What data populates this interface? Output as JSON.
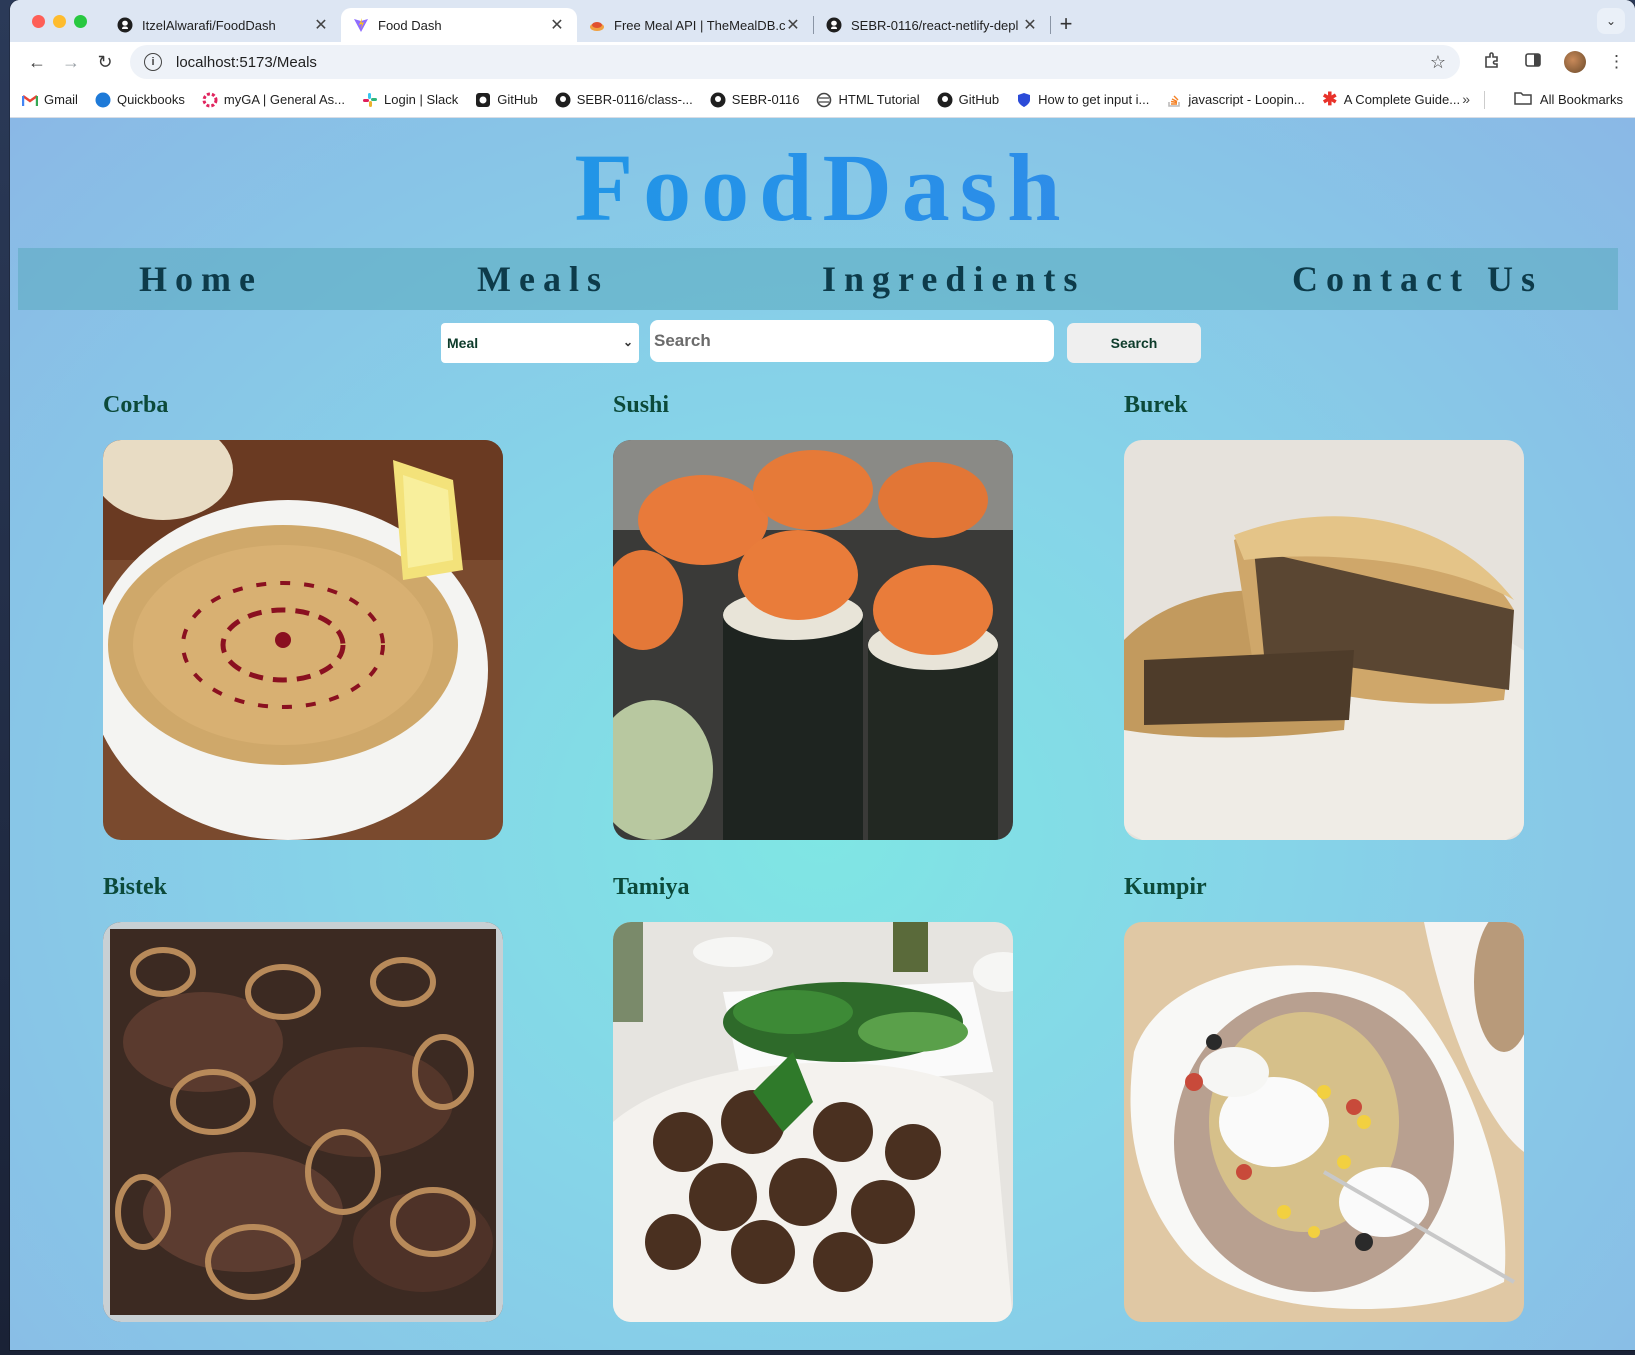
{
  "browser": {
    "tabs": [
      {
        "title": "ItzelAlwarafi/FoodDash",
        "icon": "github-icon",
        "active": false
      },
      {
        "title": "Food Dash",
        "icon": "vite-icon",
        "active": true
      },
      {
        "title": "Free Meal API | TheMealDB.co",
        "icon": "mealdb-icon",
        "active": false
      },
      {
        "title": "SEBR-0116/react-netlify-depl",
        "icon": "github-icon",
        "active": false
      }
    ],
    "new_tab": "+",
    "url": "localhost:5173/Meals",
    "bookmarks": [
      {
        "label": "Gmail",
        "icon": "gmail-icon"
      },
      {
        "label": "Quickbooks",
        "icon": "quickbooks-icon"
      },
      {
        "label": "myGA | General As...",
        "icon": "ga-icon"
      },
      {
        "label": "Login | Slack",
        "icon": "slack-icon"
      },
      {
        "label": "GitHub",
        "icon": "github-icon"
      },
      {
        "label": "SEBR-0116/class-...",
        "icon": "github-icon"
      },
      {
        "label": "SEBR-0116",
        "icon": "github-icon"
      },
      {
        "label": "HTML Tutorial",
        "icon": "globe-icon"
      },
      {
        "label": "GitHub",
        "icon": "github-icon"
      },
      {
        "label": "How to get input i...",
        "icon": "shield-icon"
      },
      {
        "label": "javascript - Loopin...",
        "icon": "stackoverflow-icon"
      },
      {
        "label": "A Complete Guide...",
        "icon": "asterisk-icon"
      }
    ],
    "all_bookmarks": "All Bookmarks"
  },
  "app": {
    "brand": "FoodDash",
    "nav": [
      "Home",
      "Meals",
      "Ingredients",
      "Contact Us"
    ],
    "search": {
      "select_value": "Meal",
      "placeholder": "Search",
      "button": "Search"
    },
    "meals": [
      {
        "name": "Corba"
      },
      {
        "name": "Sushi"
      },
      {
        "name": "Burek"
      },
      {
        "name": "Bistek"
      },
      {
        "name": "Tamiya"
      },
      {
        "name": "Kumpir"
      }
    ]
  },
  "colors": {
    "brand_gradient": [
      "#16a0e6",
      "#4f87e8"
    ],
    "nav_text": "#0d3b4a",
    "meal_title": "#0c4a3a"
  }
}
